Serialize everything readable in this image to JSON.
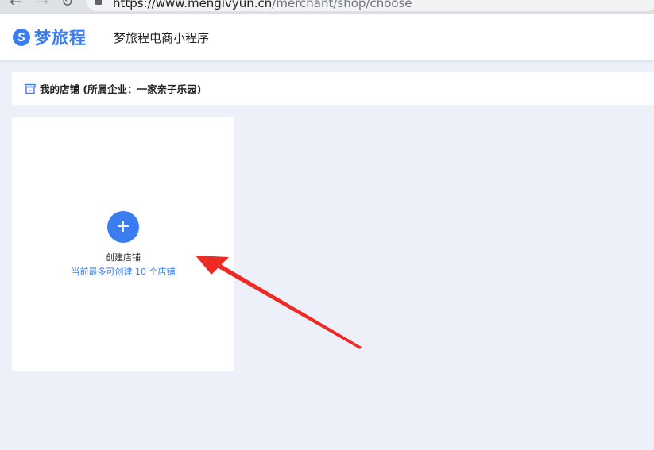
{
  "browser": {
    "back_glyph": "←",
    "forward_glyph": "→",
    "reload_glyph": "↻",
    "url_host": "https://www.mengivyun.cn",
    "url_path": "/merchant/shop/choose"
  },
  "header": {
    "logo_text": "梦旅程",
    "app_title": "梦旅程电商小程序"
  },
  "section": {
    "title": "我的店铺 (所属企业：一家亲子乐园)"
  },
  "create_card": {
    "plus_glyph": "+",
    "label": "创建店铺",
    "limit_text": "当前最多可创建 10 个店铺"
  },
  "colors": {
    "accent": "#3b7cf0",
    "arrow": "#ee2a24",
    "background": "#edf0f8"
  }
}
